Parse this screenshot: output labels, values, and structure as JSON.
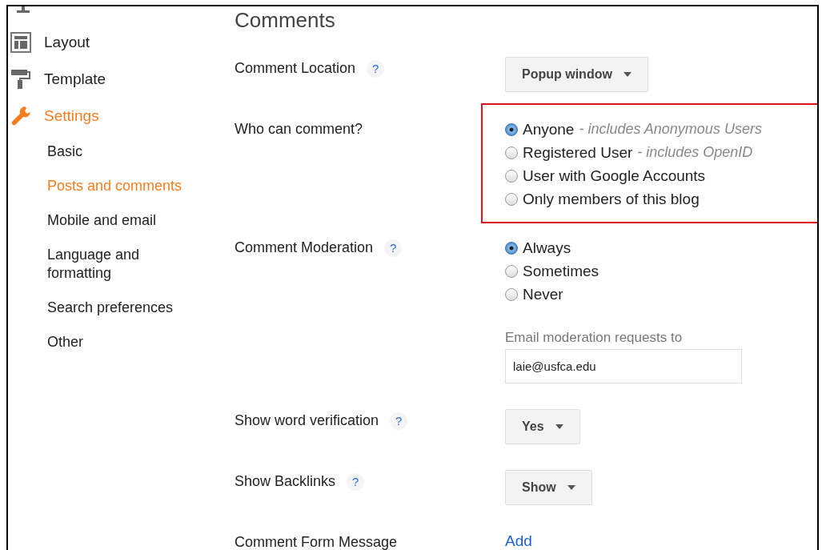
{
  "sidebar": {
    "items": [
      {
        "label": "Layout",
        "kind": "layout",
        "selected": false
      },
      {
        "label": "Template",
        "kind": "template",
        "selected": false
      },
      {
        "label": "Settings",
        "kind": "settings",
        "selected": true,
        "children": [
          {
            "label": "Basic",
            "selected": false
          },
          {
            "label": "Posts and comments",
            "selected": true
          },
          {
            "label": "Mobile and email",
            "selected": false
          },
          {
            "label": "Language and formatting",
            "selected": false
          },
          {
            "label": "Search preferences",
            "selected": false
          },
          {
            "label": "Other",
            "selected": false
          }
        ]
      }
    ]
  },
  "section": {
    "title": "Comments",
    "rows": [
      {
        "kind": "dropdown",
        "label": "Comment Location",
        "help": "?",
        "value": "Popup window"
      },
      {
        "kind": "radio",
        "label": "Who can comment?",
        "highlighted": true,
        "options": [
          {
            "label": "Anyone",
            "note": "- includes Anonymous Users",
            "selected": true
          },
          {
            "label": "Registered User",
            "note": "- includes OpenID",
            "selected": false
          },
          {
            "label": "User with Google Accounts",
            "selected": false
          },
          {
            "label": "Only members of this blog",
            "selected": false
          }
        ]
      },
      {
        "kind": "radio",
        "label": "Comment Moderation",
        "help": "?",
        "options": [
          {
            "label": "Always",
            "selected": true
          },
          {
            "label": "Sometimes",
            "selected": false
          },
          {
            "label": "Never",
            "selected": false
          }
        ],
        "email": {
          "label": "Email moderation requests to",
          "value": "laie@usfca.edu"
        }
      },
      {
        "kind": "dropdown",
        "label": "Show word verification",
        "help": "?",
        "value": "Yes"
      },
      {
        "kind": "dropdown",
        "label": "Show Backlinks",
        "help": "?",
        "value": "Show"
      },
      {
        "kind": "link",
        "label": "Comment Form Message",
        "value": "Add"
      }
    ]
  }
}
